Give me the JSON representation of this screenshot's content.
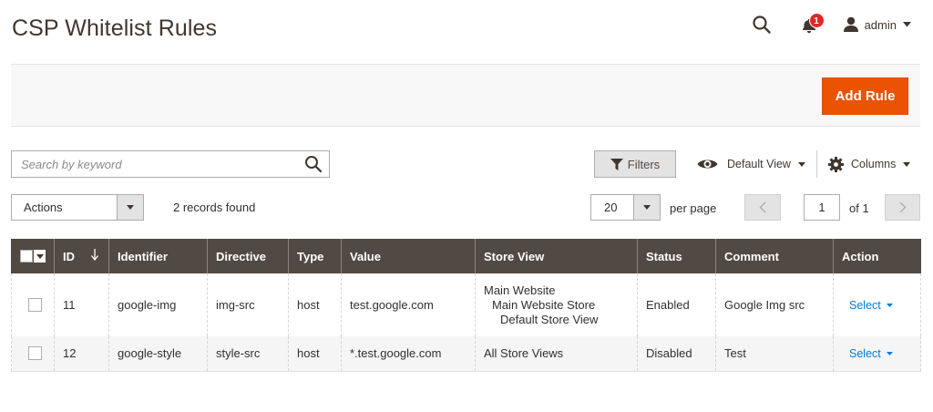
{
  "page": {
    "title": "CSP Whitelist Rules"
  },
  "header": {
    "notification_count": "1",
    "user_name": "admin"
  },
  "toolbar": {
    "add_rule_label": "Add Rule"
  },
  "grid_controls": {
    "search_placeholder": "Search by keyword",
    "filters_label": "Filters",
    "view_label": "Default View",
    "columns_label": "Columns",
    "actions_label": "Actions",
    "records_found": "2 records found",
    "per_page_value": "20",
    "per_page_label": "per page",
    "current_page": "1",
    "of_pages": "of 1"
  },
  "table": {
    "columns": [
      "ID",
      "Identifier",
      "Directive",
      "Type",
      "Value",
      "Store View",
      "Status",
      "Comment",
      "Action"
    ],
    "rows": [
      {
        "id": "11",
        "identifier": "google-img",
        "directive": "img-src",
        "type": "host",
        "value": "test.google.com",
        "store_view": [
          "Main Website",
          "Main Website Store",
          "Default Store View"
        ],
        "status": "Enabled",
        "comment": "Google Img src",
        "action": "Select"
      },
      {
        "id": "12",
        "identifier": "google-style",
        "directive": "style-src",
        "type": "host",
        "value": "*.test.google.com",
        "store_view": [
          "All Store Views"
        ],
        "status": "Disabled",
        "comment": "Test",
        "action": "Select"
      }
    ]
  },
  "colors": {
    "accent": "#eb5202",
    "table_header": "#514943",
    "link": "#007bdb",
    "badge": "#e22626"
  },
  "icons": {
    "search": "search-icon",
    "notifications": "bell-icon",
    "user": "user-icon",
    "filter": "funnel-icon",
    "view": "eye-icon",
    "columns": "gear-icon"
  }
}
